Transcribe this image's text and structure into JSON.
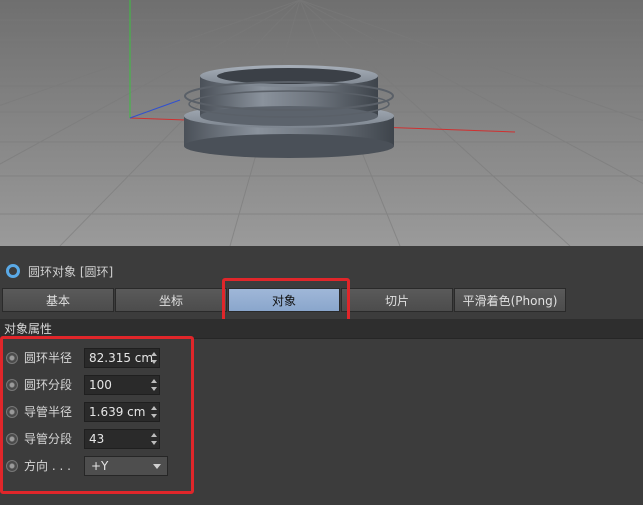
{
  "object_header": {
    "title": "圆环对象 [圆环]",
    "icon": "torus-object-icon"
  },
  "tabs": [
    {
      "label": "基本",
      "active": false
    },
    {
      "label": "坐标",
      "active": false
    },
    {
      "label": "对象",
      "active": true
    },
    {
      "label": "切片",
      "active": false
    },
    {
      "label": "平滑着色(Phong)",
      "active": false
    }
  ],
  "section_title": "对象属性",
  "properties": [
    {
      "label": "圆环半径",
      "value": "82.315 cm"
    },
    {
      "label": "圆环分段",
      "value": "100"
    },
    {
      "label": "导管半径",
      "value": "1.639 cm"
    },
    {
      "label": "导管分段",
      "value": "43"
    }
  ],
  "orientation": {
    "label": "方向 . . .",
    "value": "+Y"
  },
  "colors": {
    "highlight": "#e0262a",
    "active_tab": "#8aa6cc",
    "object_icon": "#5aa9e6"
  }
}
